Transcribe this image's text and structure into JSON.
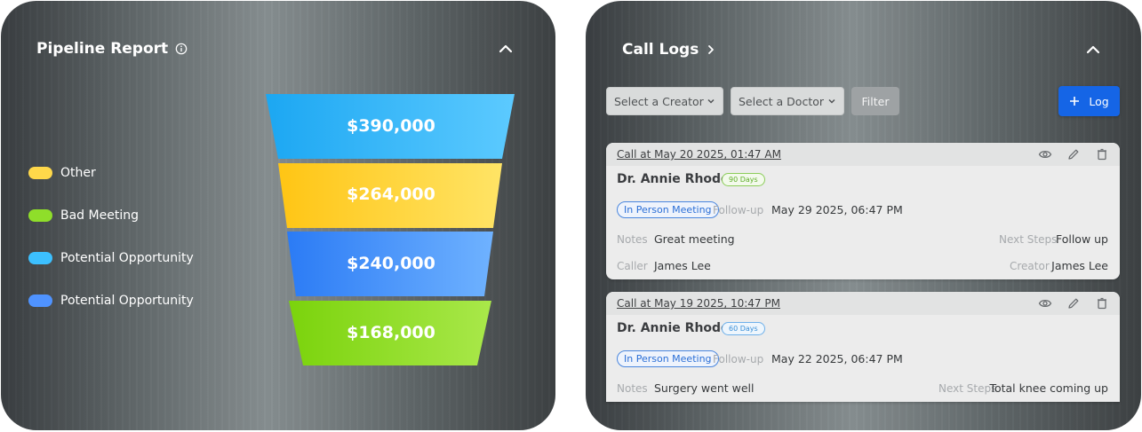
{
  "pipeline": {
    "title": "Pipeline Report",
    "legend": [
      {
        "label": "Other",
        "color": "#ffd84a"
      },
      {
        "label": "Bad Meeting",
        "color": "#8fde2a"
      },
      {
        "label": "Potential Opportunity",
        "color": "#3cc0ff"
      },
      {
        "label": "Potential Opportunity",
        "color": "#4f93ff"
      }
    ],
    "funnel": [
      {
        "value": "$390,000",
        "color_start": "#1ca7f2",
        "color_end": "#5ccaff"
      },
      {
        "value": "$264,000",
        "color_start": "#ffc514",
        "color_end": "#ffe466"
      },
      {
        "value": "$240,000",
        "color_start": "#2b7bf5",
        "color_end": "#6fb2ff"
      },
      {
        "value": "$168,000",
        "color_start": "#7bd30c",
        "color_end": "#a9e84a"
      }
    ]
  },
  "calllogs": {
    "title": "Call Logs",
    "creator_placeholder": "Select a Creator",
    "doctor_placeholder": "Select a Doctor",
    "filter_label": "Filter",
    "log_label": "Log",
    "cards": [
      {
        "when": "Call at May 20 2025, 01:47 AM",
        "doctor": "Dr. Annie Rhode",
        "days": "90 Days",
        "type": "In Person Meeting",
        "followup_label": "Follow-up",
        "followup": "May 29 2025, 06:47 PM",
        "notes_label": "Notes",
        "notes": "Great meeting",
        "nextsteps_label": "Next Steps",
        "nextsteps": "Follow up",
        "caller_label": "Caller",
        "caller": "James Lee",
        "creator_label": "Creator",
        "creator": "James Lee"
      },
      {
        "when": "Call at May 19 2025, 10:47 PM",
        "doctor": "Dr. Annie Rhode",
        "days": "60 Days",
        "type": "In Person Meeting",
        "followup_label": "Follow-up",
        "followup": "May 22 2025, 06:47 PM",
        "notes_label": "Notes",
        "notes": "Surgery went well",
        "nextsteps_label": "Next Steps",
        "nextsteps": "Total knee coming up"
      }
    ]
  }
}
